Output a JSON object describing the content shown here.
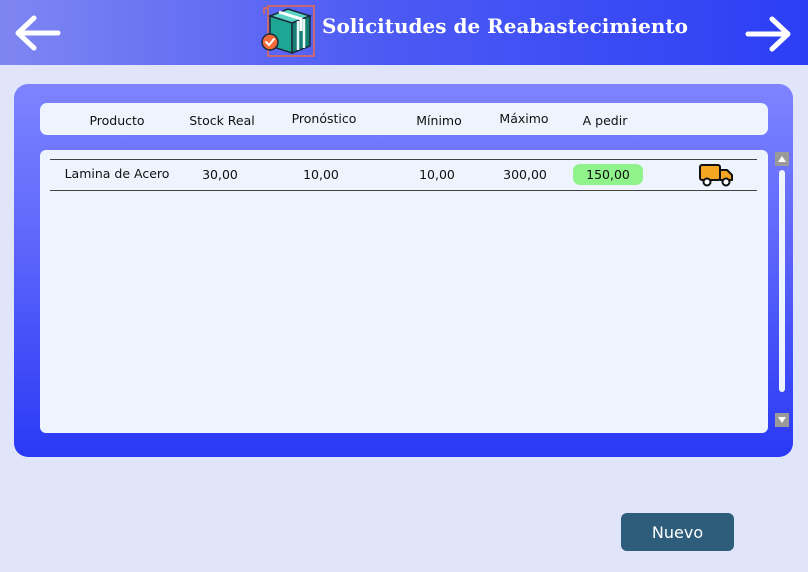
{
  "header": {
    "title": "Solicitudes de Reabastecimiento",
    "back_icon": "arrow-left-icon",
    "forward_icon": "arrow-right-icon",
    "logo_icon": "box-check-icon"
  },
  "table": {
    "columns": [
      "Producto",
      "Stock Real",
      "Pronóstico",
      "Mínimo",
      "Máximo",
      "A pedir"
    ],
    "rows": [
      {
        "producto": "Lamina de Acero",
        "stock_real": "30,00",
        "pronostico": "10,00",
        "minimo": "10,00",
        "maximo": "300,00",
        "a_pedir": "150,00",
        "action_icon": "truck-icon"
      }
    ]
  },
  "actions": {
    "nuevo_label": "Nuevo"
  },
  "colors": {
    "header_gradient": [
      "#7f86f2",
      "#2c3ef5"
    ],
    "panel_gradient": [
      "#7e83ff",
      "#2a39f5"
    ],
    "background": "#e1e5fb",
    "a_pedir_badge": "#8ff28a",
    "button": "#2e5d7b",
    "truck": "#f5a623"
  }
}
